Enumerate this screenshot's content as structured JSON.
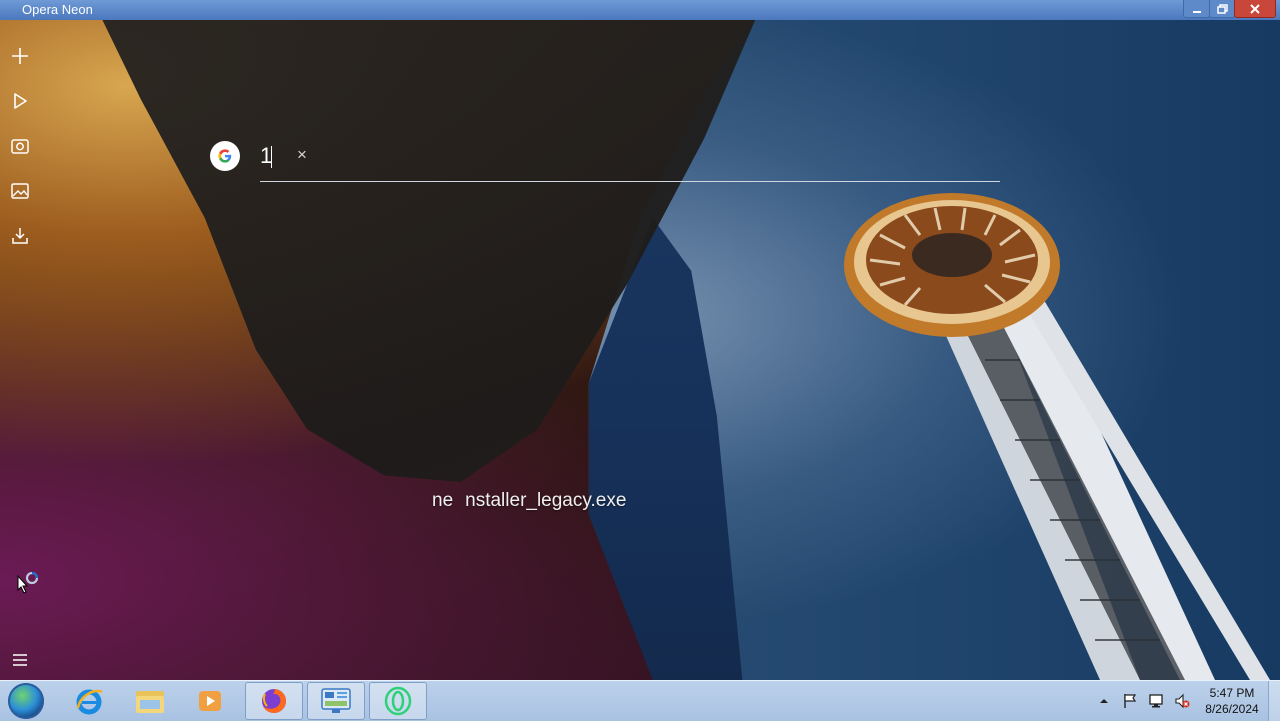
{
  "window": {
    "title": "Opera Neon",
    "controls": [
      "minimize",
      "restore",
      "close"
    ]
  },
  "sidebar": {
    "items": [
      {
        "icon": "plus-icon",
        "action": "new-tab"
      },
      {
        "icon": "play-icon",
        "action": "media-player"
      },
      {
        "icon": "camera-icon",
        "action": "snapshot"
      },
      {
        "icon": "image-icon",
        "action": "gallery"
      },
      {
        "icon": "download-icon",
        "action": "downloads"
      }
    ],
    "menu_icon": "hamburger-menu-icon"
  },
  "search": {
    "engine_icon": "google-g-icon",
    "value": "1",
    "clear_glyph": "×"
  },
  "download": {
    "filename_left": "ne",
    "filename_right": "nstaller_legacy.exe"
  },
  "taskbar": {
    "pinned": [
      {
        "icon": "internet-explorer-icon"
      },
      {
        "icon": "file-explorer-icon"
      },
      {
        "icon": "media-player-icon"
      },
      {
        "icon": "firefox-icon",
        "active": true
      },
      {
        "icon": "control-panel-icon",
        "active": true
      },
      {
        "icon": "opera-neon-icon",
        "active": true
      }
    ],
    "tray": [
      "show-hidden-icons",
      "action-center-flag-icon",
      "network-icon",
      "volume-muted-icon"
    ],
    "clock": {
      "time": "5:47 PM",
      "date": "8/26/2024"
    }
  },
  "colors": {
    "titlebar": "#4b78be",
    "taskbar": "#a9c2e2",
    "close": "#c9473a",
    "opera_neon_green": "#2fd07a"
  }
}
